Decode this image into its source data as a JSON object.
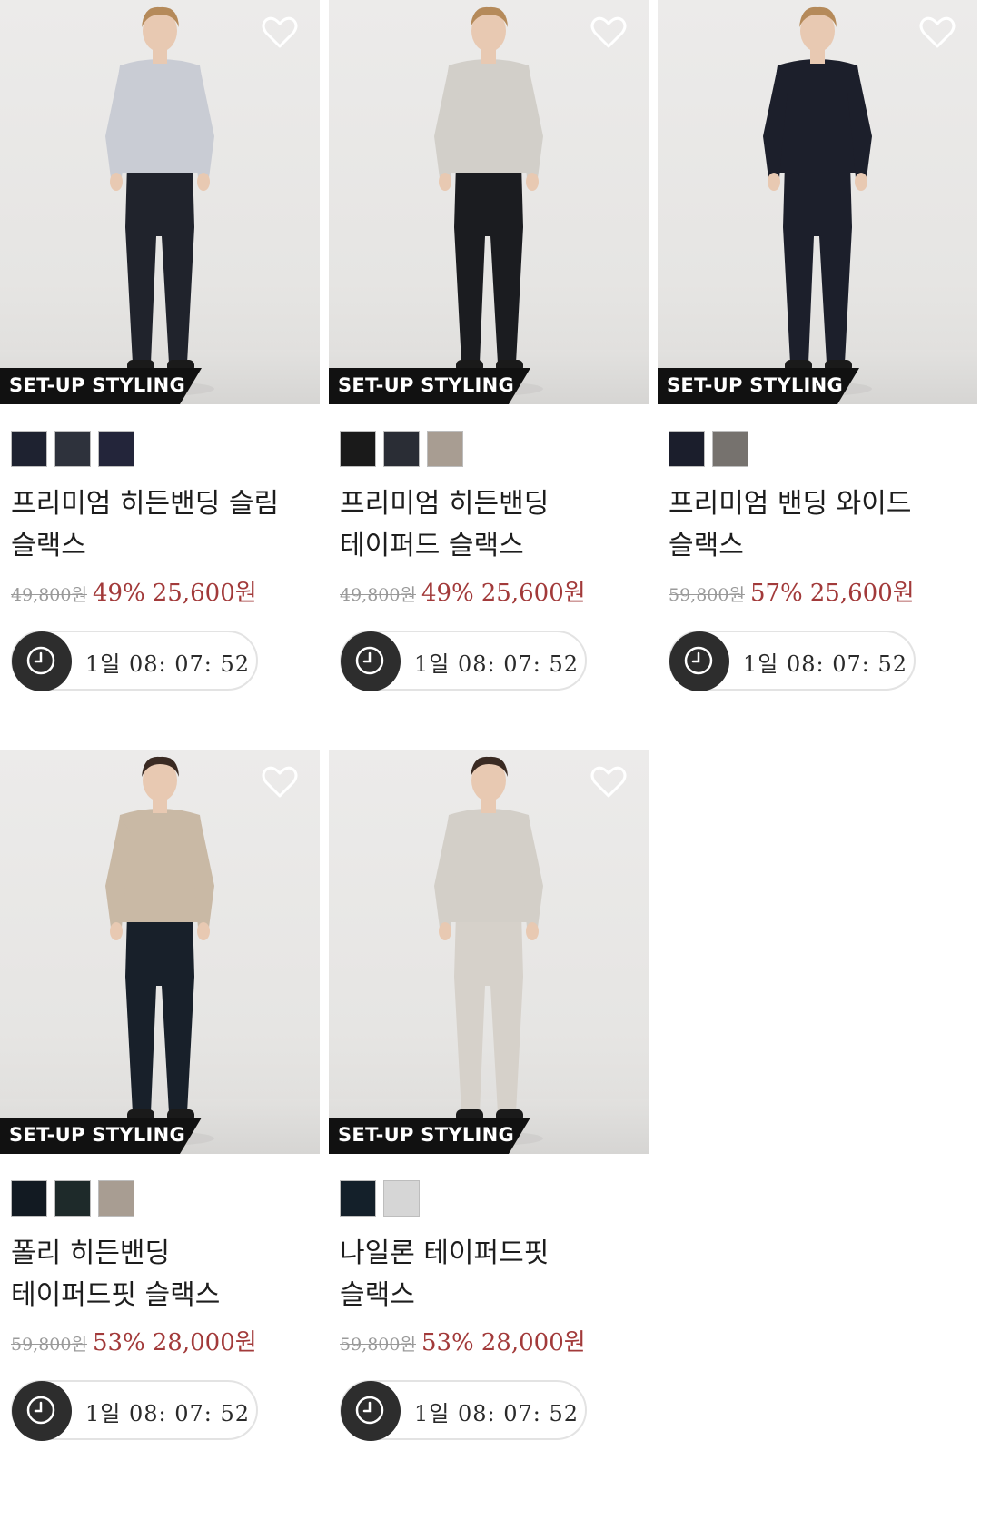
{
  "badge_text": "SET-UP STYLING",
  "products": [
    {
      "name_line1": "프리미엄 히든밴딩 슬림",
      "name_line2": "슬랙스",
      "original_price": "49,800원",
      "discount": "49%",
      "sale_price": "25,600원",
      "timer": "1일 08: 07: 52",
      "swatches": [
        "#1e2230",
        "#2e323c",
        "#23253a"
      ],
      "top_color": "#c9ccd4",
      "pants_color": "#20232c",
      "hair_color": "#b58a5a"
    },
    {
      "name_line1": "프리미엄 히든밴딩",
      "name_line2": "테이퍼드 슬랙스",
      "original_price": "49,800원",
      "discount": "49%",
      "sale_price": "25,600원",
      "timer": "1일 08: 07: 52",
      "swatches": [
        "#1a1a1a",
        "#2a2d35",
        "#a89d92"
      ],
      "top_color": "#d2cfc9",
      "pants_color": "#1b1c20",
      "hair_color": "#b58a5a"
    },
    {
      "name_line1": "프리미엄 밴딩 와이드",
      "name_line2": "슬랙스",
      "original_price": "59,800원",
      "discount": "57%",
      "sale_price": "25,600원",
      "timer": "1일 08: 07: 52",
      "swatches": [
        "#1b1e2c",
        "#76726e"
      ],
      "top_color": "#1c1f2b",
      "pants_color": "#1c1f2b",
      "hair_color": "#b58a5a"
    },
    {
      "name_line1": "폴리 히든밴딩",
      "name_line2": "테이퍼드핏 슬랙스",
      "original_price": "59,800원",
      "discount": "53%",
      "sale_price": "28,000원",
      "timer": "1일 08: 07: 52",
      "swatches": [
        "#121a22",
        "#1e2a2a",
        "#a89d92"
      ],
      "top_color": "#c9b9a5",
      "pants_color": "#18202a",
      "hair_color": "#3a2a22"
    },
    {
      "name_line1": "나일론 테이퍼드핏",
      "name_line2": "슬랙스",
      "original_price": "59,800원",
      "discount": "53%",
      "sale_price": "28,000원",
      "timer": "1일 08: 07: 52",
      "swatches": [
        "#14202a",
        "#d6d6d6"
      ],
      "top_color": "#d3cfc8",
      "pants_color": "#d6d1ca",
      "hair_color": "#3a2a22"
    }
  ]
}
